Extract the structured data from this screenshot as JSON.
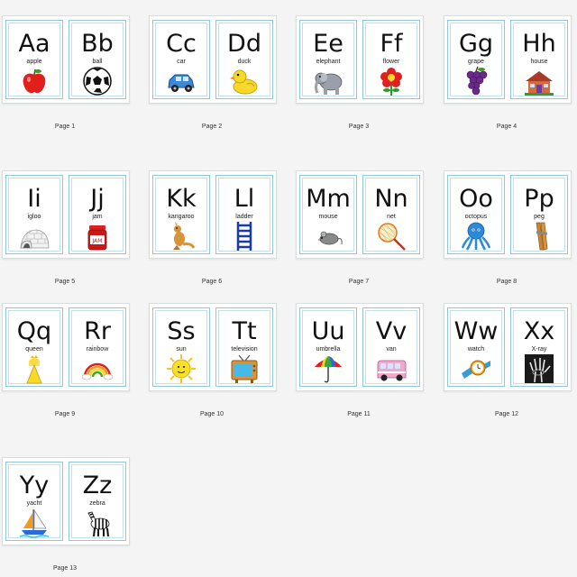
{
  "pages": [
    {
      "label": "Page 1",
      "cards": [
        {
          "letters": "Aa",
          "word": "apple",
          "icon": "apple-icon"
        },
        {
          "letters": "Bb",
          "word": "ball",
          "icon": "ball-icon"
        }
      ]
    },
    {
      "label": "Page 2",
      "cards": [
        {
          "letters": "Cc",
          "word": "car",
          "icon": "car-icon"
        },
        {
          "letters": "Dd",
          "word": "duck",
          "icon": "duck-icon"
        }
      ]
    },
    {
      "label": "Page 3",
      "cards": [
        {
          "letters": "Ee",
          "word": "elephant",
          "icon": "elephant-icon"
        },
        {
          "letters": "Ff",
          "word": "flower",
          "icon": "flower-icon"
        }
      ]
    },
    {
      "label": "Page 4",
      "cards": [
        {
          "letters": "Gg",
          "word": "grape",
          "icon": "grape-icon"
        },
        {
          "letters": "Hh",
          "word": "house",
          "icon": "house-icon"
        }
      ]
    },
    {
      "label": "Page 5",
      "cards": [
        {
          "letters": "Ii",
          "word": "igloo",
          "icon": "igloo-icon"
        },
        {
          "letters": "Jj",
          "word": "jam",
          "icon": "jam-icon"
        }
      ]
    },
    {
      "label": "Page 6",
      "cards": [
        {
          "letters": "Kk",
          "word": "kangaroo",
          "icon": "kangaroo-icon"
        },
        {
          "letters": "Ll",
          "word": "ladder",
          "icon": "ladder-icon"
        }
      ]
    },
    {
      "label": "Page 7",
      "cards": [
        {
          "letters": "Mm",
          "word": "mouse",
          "icon": "mouse-icon"
        },
        {
          "letters": "Nn",
          "word": "net",
          "icon": "net-icon"
        }
      ]
    },
    {
      "label": "Page 8",
      "cards": [
        {
          "letters": "Oo",
          "word": "octopus",
          "icon": "octopus-icon"
        },
        {
          "letters": "Pp",
          "word": "peg",
          "icon": "peg-icon"
        }
      ]
    },
    {
      "label": "Page 9",
      "cards": [
        {
          "letters": "Qq",
          "word": "queen",
          "icon": "queen-icon"
        },
        {
          "letters": "Rr",
          "word": "rainbow",
          "icon": "rainbow-icon"
        }
      ]
    },
    {
      "label": "Page 10",
      "cards": [
        {
          "letters": "Ss",
          "word": "sun",
          "icon": "sun-icon"
        },
        {
          "letters": "Tt",
          "word": "television",
          "icon": "television-icon"
        }
      ]
    },
    {
      "label": "Page 11",
      "cards": [
        {
          "letters": "Uu",
          "word": "umbrella",
          "icon": "umbrella-icon"
        },
        {
          "letters": "Vv",
          "word": "van",
          "icon": "van-icon"
        }
      ]
    },
    {
      "label": "Page 12",
      "cards": [
        {
          "letters": "Ww",
          "word": "watch",
          "icon": "watch-icon"
        },
        {
          "letters": "Xx",
          "word": "X-ray",
          "icon": "xray-icon"
        }
      ]
    },
    {
      "label": "Page 13",
      "cards": [
        {
          "letters": "Yy",
          "word": "yacht",
          "icon": "yacht-icon"
        },
        {
          "letters": "Zz",
          "word": "zebra",
          "icon": "zebra-icon"
        }
      ]
    }
  ],
  "colors": {
    "card_border": "#8fc7dc",
    "background": "#f4f4f4"
  }
}
